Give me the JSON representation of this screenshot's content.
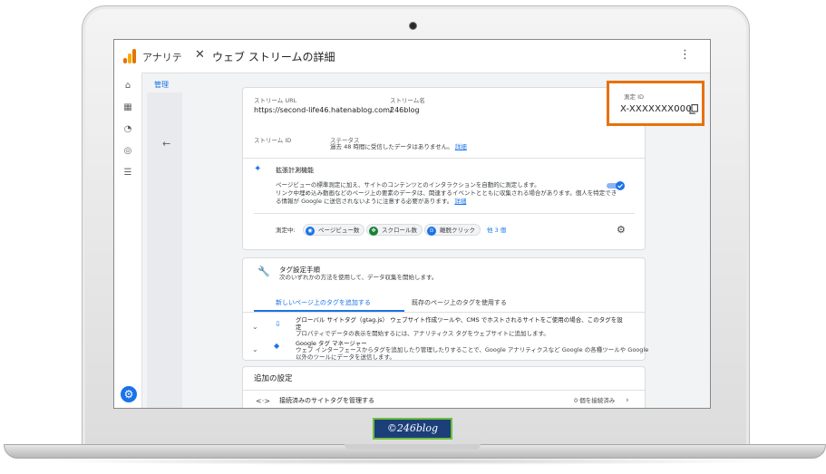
{
  "app": {
    "title": "アナリテ"
  },
  "admin": {
    "tab_label": "管理"
  },
  "panel": {
    "title": "ウェブ ストリームの詳細"
  },
  "stream": {
    "url_label": "ストリーム URL",
    "url_value": "https://second-life46.hatenablog.com/",
    "name_label": "ストリーム名",
    "name_value": "246blog",
    "id_label": "ストリーム ID",
    "status_label": "ステータス",
    "status_text": "過去 48 時間に受信したデータはありません。",
    "status_link": "詳細",
    "measurement_label": "測定 ID",
    "measurement_value": "X-XXXXXXX000"
  },
  "enhanced": {
    "title": "拡張計測機能",
    "line1": "ページビューの標準測定に加え、サイトのコンテンツとのインタラクションを自動的に測定します。",
    "line2": "リンク中埋め込み動画などのページ上の要素のデータは、関連するイベントとともに収集される場合があります。個人を特定でき",
    "line3": "る情報が Google に送信されないように注意する必要があります。",
    "link": "詳細",
    "measuring_label": "測定中:",
    "chips": [
      "ページビュー数",
      "スクロール数",
      "離脱クリック"
    ],
    "more": "他 3 個"
  },
  "tag": {
    "title": "タグ設定手順",
    "subtitle": "次のいずれかの方法を使用して、データ収集を開始します。",
    "tab_new": "新しいページ上のタグを追加する",
    "tab_existing": "既存のページ上のタグを使用する",
    "gtag_title": "グローバル サイトタグ（gtag.js） ウェブサイト作成ツールや、CMS でホストされるサイトをご使用の場合、このタグを設",
    "gtag_title2": "定",
    "gtag_desc": "プロパティでデータの表示を開始するには、アナリティクス タグをウェブサイトに追加します。",
    "gtm_title": "Google タグ マネージャー",
    "gtm_desc1": "ウェブ インターフェースからタグを追加したり管理したりすることで、Google アナリティクスなど Google の各種ツールや Google",
    "gtm_desc2": "以外のツールにデータを送信します。"
  },
  "additional": {
    "title": "追加の設定",
    "connected_title": "接続済みのサイトタグを管理する",
    "connected_count": "0 個を接続済み"
  },
  "watermark": "©246blog",
  "colors": {
    "accent": "#1a73e8",
    "highlight": "#e8710a",
    "watermark_bg": "#1c3f7a"
  }
}
